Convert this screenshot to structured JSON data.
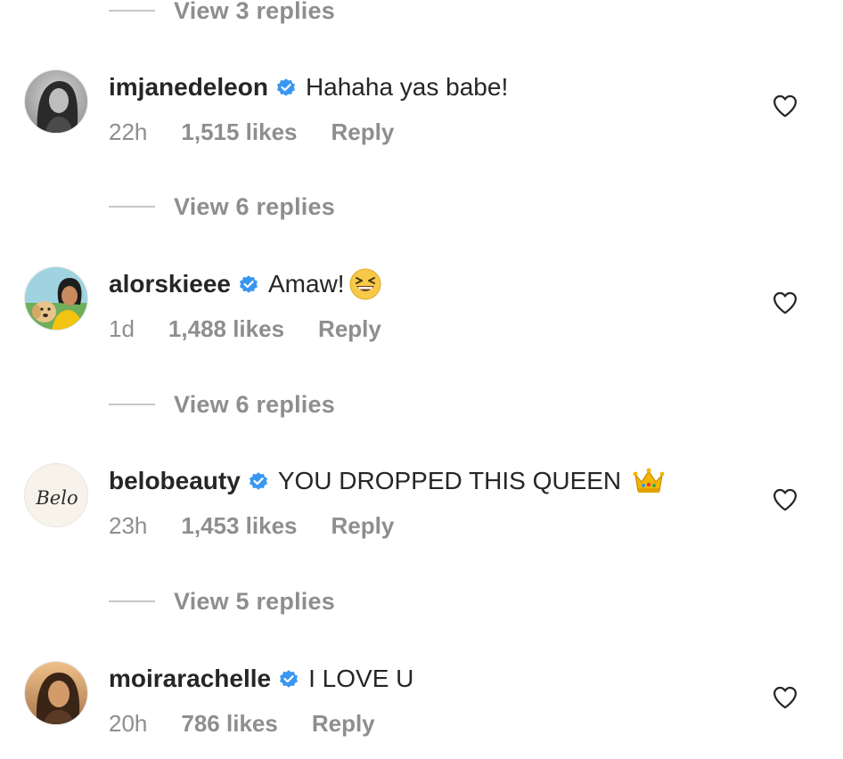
{
  "top": {
    "view_replies": "View 3 replies"
  },
  "comments": [
    {
      "username": "imjanedeleon",
      "text": "Hahaha yas babe!",
      "time": "22h",
      "likes": "1,515 likes",
      "reply": "Reply",
      "view_replies": "View 6 replies",
      "emoji": null
    },
    {
      "username": "alorskieee",
      "text": "Amaw!",
      "time": "1d",
      "likes": "1,488 likes",
      "reply": "Reply",
      "view_replies": "View 6 replies",
      "emoji": "grinning-squinting-face-emoji"
    },
    {
      "username": "belobeauty",
      "text": "YOU DROPPED THIS QUEEN",
      "time": "23h",
      "likes": "1,453 likes",
      "reply": "Reply",
      "view_replies": "View 5 replies",
      "emoji": "crown-emoji",
      "avatar_text": "Belo"
    },
    {
      "username": "moirarachelle",
      "text": "I LOVE U",
      "time": "20h",
      "likes": "786 likes",
      "reply": "Reply",
      "emoji": null
    }
  ],
  "icons": {
    "verified": "verified-badge-icon",
    "like": "heart-outline-icon"
  },
  "colors": {
    "text": "#262626",
    "muted": "#8e8e8e",
    "verified": "#3897f0",
    "divider": "#c7c7c7"
  }
}
